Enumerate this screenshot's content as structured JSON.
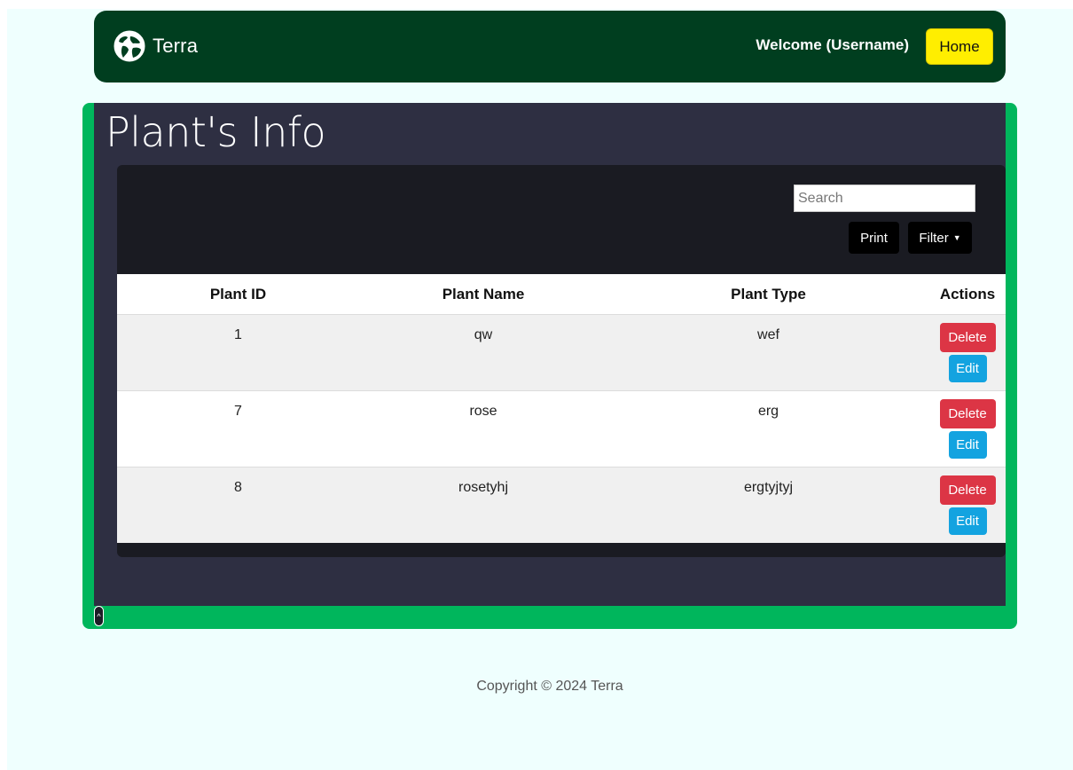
{
  "navbar": {
    "brand": "Terra",
    "welcome": "Welcome (Username)",
    "home_label": "Home"
  },
  "page": {
    "heading": "Plant's Info"
  },
  "toolbar": {
    "search_placeholder": "Search",
    "print_label": "Print",
    "filter_label": "Filter"
  },
  "table": {
    "headers": [
      "Plant ID",
      "Plant Name",
      "Plant Type",
      "Actions"
    ],
    "rows": [
      {
        "id": "1",
        "name": "qw",
        "type": "wef"
      },
      {
        "id": "7",
        "name": "rose",
        "type": "erg"
      },
      {
        "id": "8",
        "name": "rosetyhj",
        "type": "ergtyjtyj"
      }
    ],
    "delete_label": "Delete",
    "edit_label": "Edit"
  },
  "footer": {
    "copyright": "Copyright © 2024 Terra"
  },
  "colors": {
    "navbar": "#003e1f",
    "frame": "#00b65c",
    "panel": "#2e2f42",
    "home_button": "#ffee00",
    "delete_button": "#dc3545",
    "edit_button": "#13a3e0"
  },
  "icons": {
    "brand": "globe-icon",
    "scroll_top": "chevron-up-icon",
    "filter_caret": "caret-down-icon"
  }
}
